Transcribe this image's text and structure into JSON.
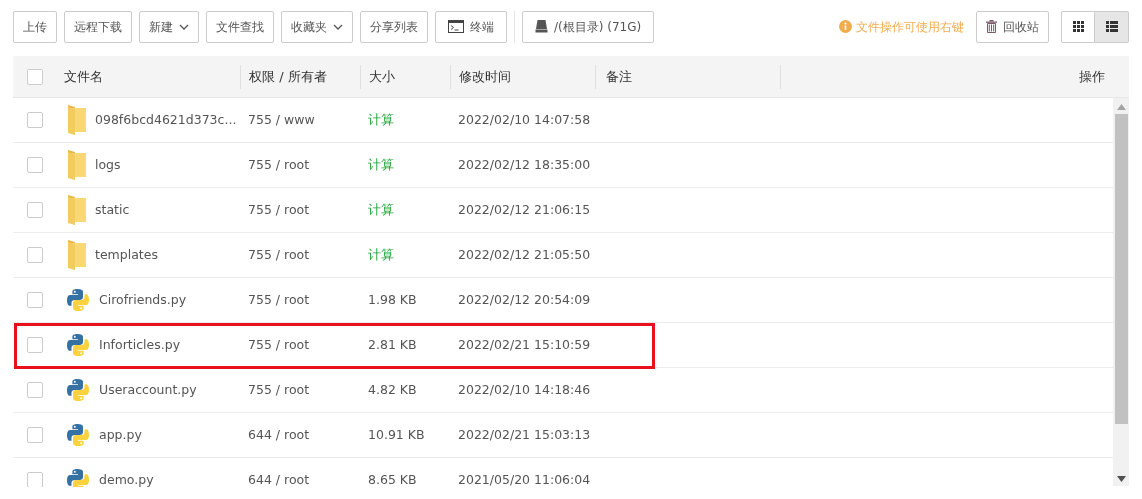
{
  "toolbar": {
    "buttons": [
      {
        "label": "上传",
        "kind": "plain"
      },
      {
        "label": "远程下载",
        "kind": "plain"
      },
      {
        "label": "新建",
        "kind": "dropdown"
      },
      {
        "label": "文件查找",
        "kind": "plain"
      },
      {
        "label": "收藏夹",
        "kind": "dropdown"
      },
      {
        "label": "分享列表",
        "kind": "plain"
      },
      {
        "label": "终端",
        "kind": "terminal"
      },
      {
        "label": "/(根目录) (71G)",
        "kind": "drive"
      }
    ],
    "hint": "文件操作可使用右键",
    "recycle_button": "回收站",
    "views": [
      {
        "kind": "grid",
        "selected": false
      },
      {
        "kind": "list",
        "selected": true
      }
    ]
  },
  "table": {
    "select_all_checked": false,
    "columns": [
      "文件名",
      "权限 / 所有者",
      "大小",
      "修改时间",
      "备注",
      "操作"
    ],
    "rows": [
      {
        "kind": "folder",
        "name": "098f6bcd4621d373c...",
        "perm": "755 / www",
        "size": {
          "text": "计算",
          "kind": "link"
        },
        "time": "2022/02/10 14:07:58",
        "checked": false,
        "highlighted": false
      },
      {
        "kind": "folder",
        "name": "logs",
        "perm": "755 / root",
        "size": {
          "text": "计算",
          "kind": "link"
        },
        "time": "2022/02/12 18:35:00",
        "checked": false,
        "highlighted": false
      },
      {
        "kind": "folder",
        "name": "static",
        "perm": "755 / root",
        "size": {
          "text": "计算",
          "kind": "link"
        },
        "time": "2022/02/12 21:06:15",
        "checked": false,
        "highlighted": false
      },
      {
        "kind": "folder",
        "name": "templates",
        "perm": "755 / root",
        "size": {
          "text": "计算",
          "kind": "link"
        },
        "time": "2022/02/12 21:05:50",
        "checked": false,
        "highlighted": false
      },
      {
        "kind": "python",
        "name": "Cirofriends.py",
        "perm": "755 / root",
        "size": {
          "text": "1.98 KB",
          "kind": "value"
        },
        "time": "2022/02/12 20:54:09",
        "checked": false,
        "highlighted": false
      },
      {
        "kind": "python",
        "name": "Inforticles.py",
        "perm": "755 / root",
        "size": {
          "text": "2.81 KB",
          "kind": "value"
        },
        "time": "2022/02/21 15:10:59",
        "checked": false,
        "highlighted": true
      },
      {
        "kind": "python",
        "name": "Useraccount.py",
        "perm": "755 / root",
        "size": {
          "text": "4.82 KB",
          "kind": "value"
        },
        "time": "2022/02/10 14:18:46",
        "checked": false,
        "highlighted": false
      },
      {
        "kind": "python",
        "name": "app.py",
        "perm": "644 / root",
        "size": {
          "text": "10.91 KB",
          "kind": "value"
        },
        "time": "2022/02/21 15:03:13",
        "checked": false,
        "highlighted": false
      },
      {
        "kind": "python",
        "name": "demo.py",
        "perm": "644 / root",
        "size": {
          "text": "8.65 KB",
          "kind": "value"
        },
        "time": "2021/05/20 11:06:04",
        "checked": false,
        "highlighted": false
      }
    ]
  }
}
